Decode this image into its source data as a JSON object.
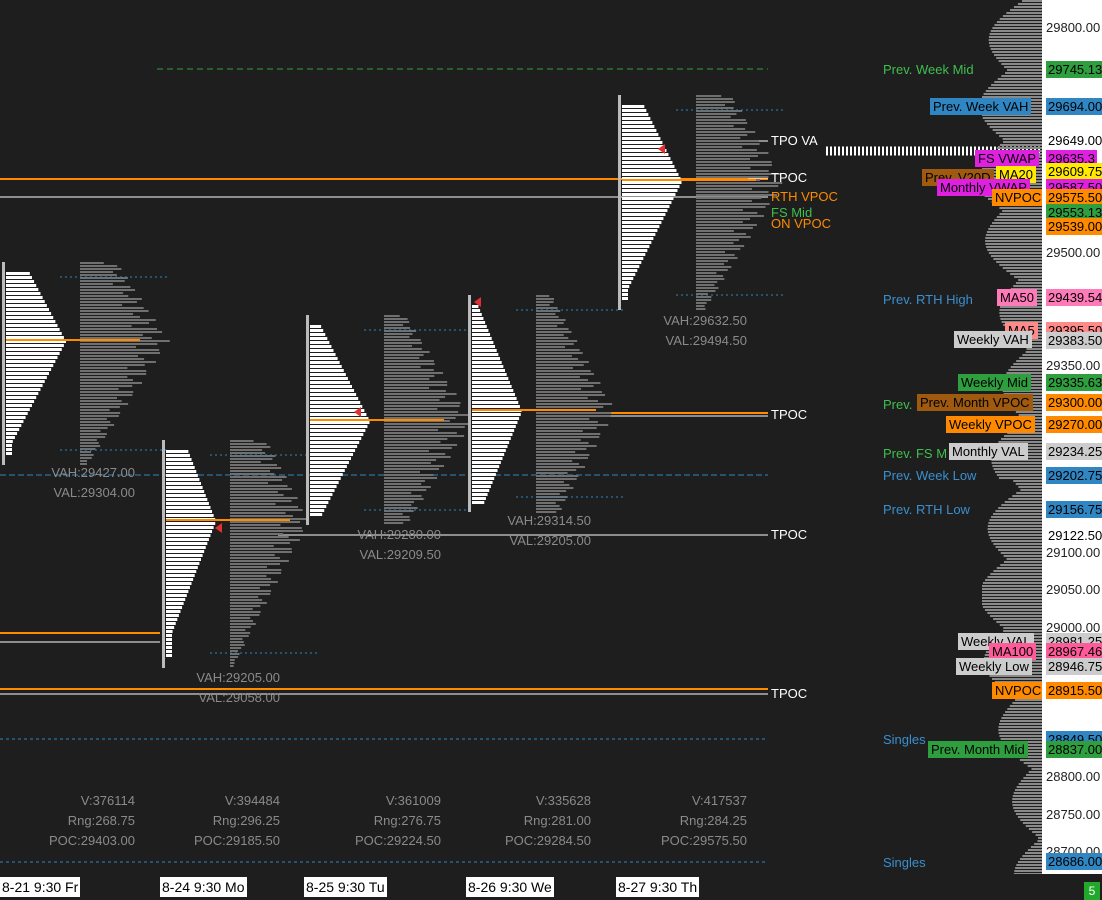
{
  "price_axis": {
    "ticks": [
      "29800.00",
      "29500.00",
      "29350.00",
      "29100.00",
      "29050.00",
      "29000.00",
      "28800.00",
      "28750.00",
      "28700.00"
    ],
    "tags": [
      {
        "text": "29745.13",
        "bg": "#2e9e3e",
        "fg": "#000"
      },
      {
        "text": "29694.00",
        "bg": "#2f86c3",
        "fg": "#000"
      },
      {
        "text": "29649.00",
        "bg": "#ffffff",
        "fg": "#000"
      },
      {
        "text": "29635.3",
        "bg": "#e020e0",
        "fg": "#000"
      },
      {
        "text": "29609.75",
        "bg": "#ffea00",
        "fg": "#000"
      },
      {
        "text": "29587.50",
        "bg": "#e020e0",
        "fg": "#000"
      },
      {
        "text": "29575.50",
        "bg": "#ff8a00",
        "fg": "#000"
      },
      {
        "text": "29553.13",
        "bg": "#2e9e3e",
        "fg": "#000"
      },
      {
        "text": "29539.00",
        "bg": "#ff8a00",
        "fg": "#000"
      },
      {
        "text": "29439.54",
        "bg": "#ff7ab8",
        "fg": "#000"
      },
      {
        "text": "29395.50",
        "bg": "#ff8a8a",
        "fg": "#000"
      },
      {
        "text": "29383.50",
        "bg": "#cccccc",
        "fg": "#000"
      },
      {
        "text": "29335.63",
        "bg": "#2e9e3e",
        "fg": "#000"
      },
      {
        "text": "29300.00",
        "bg": "#ff8a00",
        "fg": "#000"
      },
      {
        "text": "29270.00",
        "bg": "#ff8a00",
        "fg": "#000"
      },
      {
        "text": "29234.25",
        "bg": "#cccccc",
        "fg": "#000"
      },
      {
        "text": "29202.75",
        "bg": "#2f86c3",
        "fg": "#000"
      },
      {
        "text": "29156.75",
        "bg": "#2f86c3",
        "fg": "#000"
      },
      {
        "text": "29122.50",
        "bg": "#ffffff",
        "fg": "#000"
      },
      {
        "text": "28981.25",
        "bg": "#cccccc",
        "fg": "#000"
      },
      {
        "text": "28967.46",
        "bg": "#ff5a9a",
        "fg": "#000"
      },
      {
        "text": "28946.75",
        "bg": "#cccccc",
        "fg": "#000"
      },
      {
        "text": "28915.50",
        "bg": "#ff8a00",
        "fg": "#000"
      },
      {
        "text": "28849.50",
        "bg": "#2f86c3",
        "fg": "#000"
      },
      {
        "text": "28837.00",
        "bg": "#2e9e3e",
        "fg": "#000"
      },
      {
        "text": "28686.00",
        "bg": "#2f86c3",
        "fg": "#000"
      }
    ]
  },
  "level_labels": [
    {
      "text": "Prev. Week Mid",
      "color": "#3fbf4f"
    },
    {
      "text": "Prev. Week VAH",
      "bg": "#2f86c3",
      "color": "#000"
    },
    {
      "text": "FS VWAP",
      "bg": "#e020e0",
      "color": "#000"
    },
    {
      "text": "MA20",
      "bg": "#ffea00",
      "color": "#000"
    },
    {
      "text": "Prev. V20D",
      "bg": "#a05a10",
      "color": "#000"
    },
    {
      "text": "Monthly VWAP",
      "bg": "#e020e0",
      "color": "#000"
    },
    {
      "text": "NVPOC",
      "bg": "#ff8a00",
      "color": "#000"
    },
    {
      "text": "Prev. RTH High",
      "color": "#3a8fd0"
    },
    {
      "text": "MA50",
      "bg": "#ff7ab8",
      "color": "#000"
    },
    {
      "text": "MA5",
      "bg": "#ff8a8a",
      "color": "#000"
    },
    {
      "text": "Weekly VAH",
      "bg": "#cccccc",
      "color": "#000"
    },
    {
      "text": "Weekly Mid",
      "bg": "#2e9e3e",
      "color": "#000"
    },
    {
      "text": "Prev.",
      "color": "#3fbf4f"
    },
    {
      "text": "Prev. Month VPOC",
      "bg": "#a05a10",
      "color": "#000"
    },
    {
      "text": "Weekly VPOC",
      "bg": "#ff8a00",
      "color": "#000"
    },
    {
      "text": "Prev. FS M",
      "color": "#3fbf4f"
    },
    {
      "text": "Monthly VAL",
      "bg": "#cccccc",
      "color": "#000"
    },
    {
      "text": "Prev. Week Low",
      "color": "#3a8fd0"
    },
    {
      "text": "Prev. RTH Low",
      "color": "#3a8fd0"
    },
    {
      "text": "Weekly VAL",
      "bg": "#cccccc",
      "color": "#000"
    },
    {
      "text": "MA100",
      "bg": "#ff5a9a",
      "color": "#000"
    },
    {
      "text": "Weekly Low",
      "bg": "#cccccc",
      "color": "#000"
    },
    {
      "text": "NVPOC",
      "bg": "#ff8a00",
      "color": "#000"
    },
    {
      "text": "Singles",
      "color": "#3a8fd0"
    },
    {
      "text": "Prev. Month Mid",
      "bg": "#2e9e3e",
      "color": "#000"
    },
    {
      "text": "Singles",
      "color": "#3a8fd0"
    }
  ],
  "right_labels": [
    {
      "text": "TPO VA",
      "color": "#ffffff"
    },
    {
      "text": "TPOC",
      "color": "#ffffff"
    },
    {
      "text": "RTH VPOC",
      "color": "#ff8a00"
    },
    {
      "text": "FS Mid",
      "color": "#3fbf4f"
    },
    {
      "text": "ON VPOC",
      "color": "#ff8a00"
    },
    {
      "text": "TPOC",
      "color": "#ffffff"
    },
    {
      "text": "TPOC",
      "color": "#ffffff"
    },
    {
      "text": "TPOC",
      "color": "#ffffff"
    }
  ],
  "va_labels": [
    {
      "vah": "VAH:29427.00",
      "val": "VAL:29304.00"
    },
    {
      "vah": "VAH:29205.00",
      "val": "VAL:29058.00"
    },
    {
      "vah": "VAH:29280.00",
      "val": "VAL:29209.50"
    },
    {
      "vah": "VAH:29314.50",
      "val": "VAL:29205.00"
    },
    {
      "vah": "VAH:29632.50",
      "val": "VAL:29494.50"
    }
  ],
  "session_stats": [
    {
      "v": "V:376114",
      "rng": "Rng:268.75",
      "poc": "POC:29403.00"
    },
    {
      "v": "V:394484",
      "rng": "Rng:296.25",
      "poc": "POC:29185.50"
    },
    {
      "v": "V:361009",
      "rng": "Rng:276.75",
      "poc": "POC:29224.50"
    },
    {
      "v": "V:335628",
      "rng": "Rng:281.00",
      "poc": "POC:29284.50"
    },
    {
      "v": "V:417537",
      "rng": "Rng:284.25",
      "poc": "POC:29575.50"
    }
  ],
  "dates": [
    "8-21  9:30 Fr",
    "8-24  9:30 Mo",
    "8-25  9:30 Tu",
    "8-26  9:30 We",
    "8-27  9:30 Th"
  ],
  "corner_badge": "5"
}
